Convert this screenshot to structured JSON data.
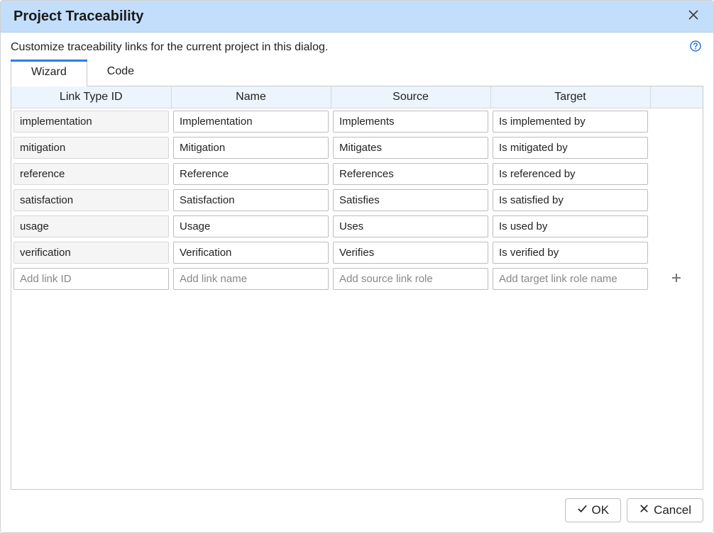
{
  "dialog": {
    "title": "Project Traceability",
    "description": "Customize traceability links for the current project in this dialog."
  },
  "tabs": [
    {
      "label": "Wizard",
      "selected": true
    },
    {
      "label": "Code",
      "selected": false
    }
  ],
  "table": {
    "columns": {
      "id": "Link Type ID",
      "name": "Name",
      "source": "Source",
      "target": "Target"
    },
    "rows": [
      {
        "id": "implementation",
        "name": "Implementation",
        "source": "Implements",
        "target": "Is implemented by"
      },
      {
        "id": "mitigation",
        "name": "Mitigation",
        "source": "Mitigates",
        "target": "Is mitigated by"
      },
      {
        "id": "reference",
        "name": "Reference",
        "source": "References",
        "target": "Is referenced by"
      },
      {
        "id": "satisfaction",
        "name": "Satisfaction",
        "source": "Satisfies",
        "target": "Is satisfied by"
      },
      {
        "id": "usage",
        "name": "Usage",
        "source": "Uses",
        "target": "Is used by"
      },
      {
        "id": "verification",
        "name": "Verification",
        "source": "Verifies",
        "target": "Is verified by"
      }
    ],
    "add_row_placeholders": {
      "id": "Add link ID",
      "name": "Add link name",
      "source": "Add source link role",
      "target": "Add target link role name"
    }
  },
  "buttons": {
    "ok": "OK",
    "cancel": "Cancel"
  }
}
